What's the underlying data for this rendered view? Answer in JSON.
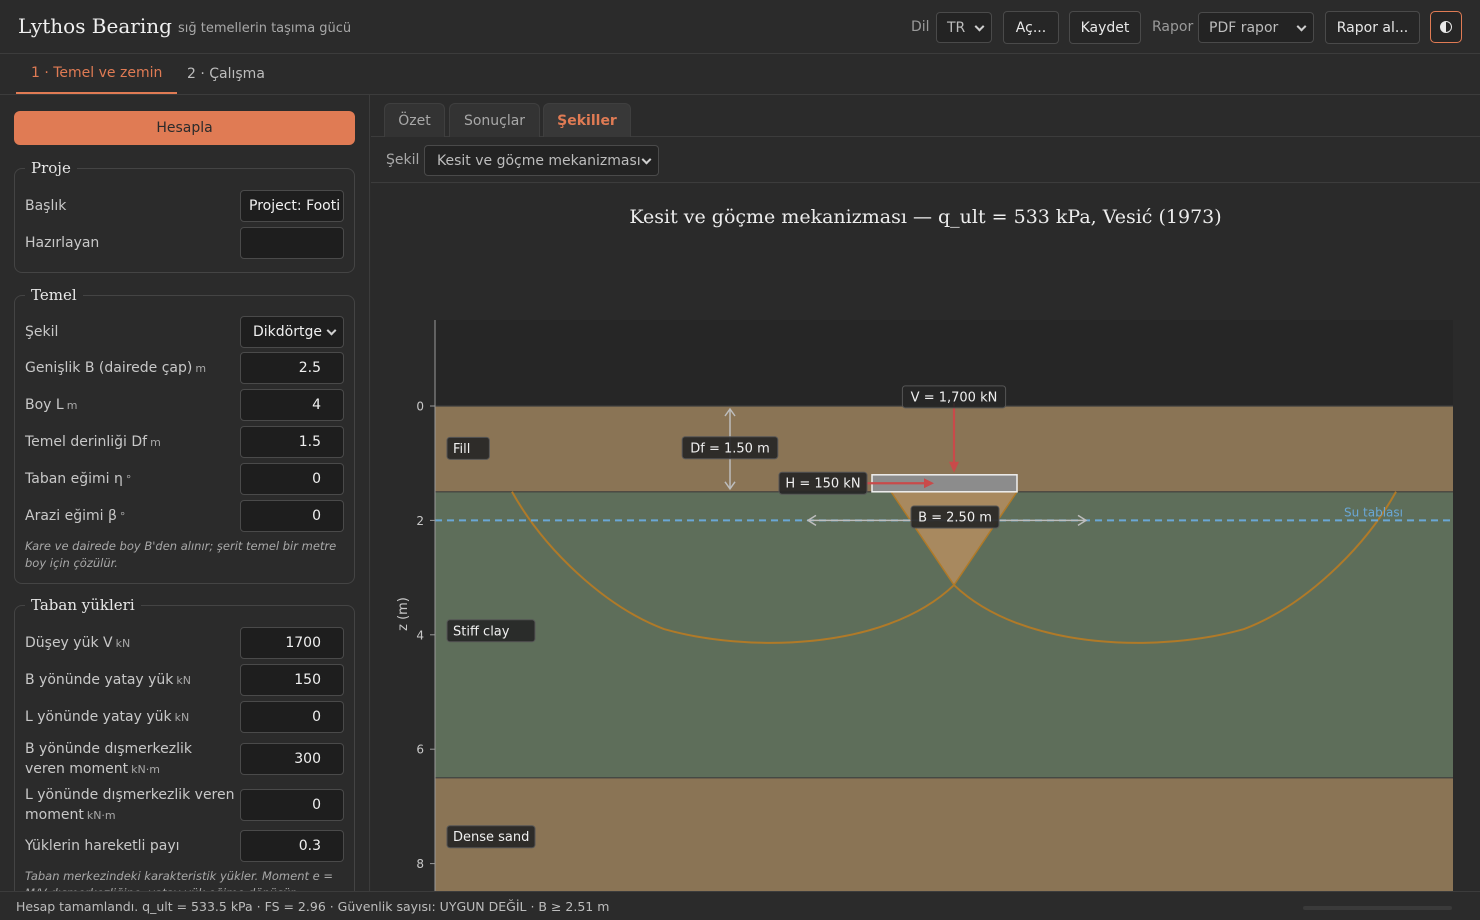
{
  "header": {
    "app_title": "Lythos Bearing",
    "app_subtitle": "sığ temellerin taşıma gücü",
    "lang_label": "Dil",
    "lang_value": "TR",
    "open_label": "Aç...",
    "save_label": "Kaydet",
    "report_label": "Rapor",
    "report_value": "PDF rapor",
    "get_report_label": "Rapor al...",
    "theme_icon": "contrast-icon"
  },
  "top_tabs": [
    {
      "label": "1 · Temel ve zemin",
      "active": true
    },
    {
      "label": "2 · Çalışma",
      "active": false
    }
  ],
  "sidebar": {
    "calculate_label": "Hesapla",
    "project": {
      "legend": "Proje",
      "title_label": "Başlık",
      "title_value": "Project: Footi",
      "prepared_label": "Hazırlayan",
      "prepared_value": ""
    },
    "foundation": {
      "legend": "Temel",
      "fields": [
        {
          "label": "Şekil",
          "unit": "",
          "value": "Dikdörtge"
        },
        {
          "label": "Genişlik B (dairede çap)",
          "unit": "m",
          "value": "2.5"
        },
        {
          "label": "Boy L",
          "unit": "m",
          "value": "4"
        },
        {
          "label": "Temel derinliği Df",
          "unit": "m",
          "value": "1.5"
        },
        {
          "label": "Taban eğimi η",
          "unit": "°",
          "value": "0"
        },
        {
          "label": "Arazi eğimi β",
          "unit": "°",
          "value": "0"
        }
      ],
      "note": "Kare ve dairede boy B'den alınır; şerit temel bir metre boy için çözülür."
    },
    "loads": {
      "legend": "Taban yükleri",
      "fields": [
        {
          "label": "Düşey yük V",
          "unit": "kN",
          "value": "1700"
        },
        {
          "label": "B yönünde yatay yük",
          "unit": "kN",
          "value": "150"
        },
        {
          "label": "L yönünde yatay yük",
          "unit": "kN",
          "value": "0"
        },
        {
          "label": "B yönünde dışmerkezlik veren moment",
          "unit": "kN·m",
          "value": "300"
        },
        {
          "label": "L yönünde dışmerkezlik veren moment",
          "unit": "kN·m",
          "value": "0"
        },
        {
          "label": "Yüklerin hareketli payı",
          "unit": "",
          "value": "0.3"
        }
      ],
      "note": "Taban merkezindeki karakteristik yükler. Moment e = M/V dışmerkezliğine, yatay yük eğime dönüşür."
    }
  },
  "results_tabs": [
    {
      "label": "Özet",
      "active": false
    },
    {
      "label": "Sonuçlar",
      "active": false
    },
    {
      "label": "Şekiller",
      "active": true
    }
  ],
  "figure_select": {
    "label": "Şekil",
    "value": "Kesit ve göçme mekanizması"
  },
  "chart_data": {
    "type": "cross-section",
    "title": "Kesit ve göçme mekanizması — q_ult = 533 kPa, Vesić (1973)",
    "ylabel": "z (m)",
    "y_ticks": [
      0,
      2,
      4,
      6,
      8
    ],
    "ylim": [
      -1.5,
      8.5
    ],
    "layers": [
      {
        "name": "Fill",
        "top": 0,
        "bottom": 1.5,
        "color": "#8a7455"
      },
      {
        "name": "Stiff clay",
        "top": 1.5,
        "bottom": 6.5,
        "color": "#5e6e5a"
      },
      {
        "name": "Dense sand",
        "top": 6.5,
        "bottom": 8.5,
        "color": "#8a7455"
      }
    ],
    "water_table": {
      "label": "Su tablası",
      "z": 2.0
    },
    "footing": {
      "B": 2.5,
      "Df": 1.5
    },
    "annotations": {
      "vertical_load": "V = 1,700 kN",
      "horizontal_load": "H = 150 kN",
      "depth": "Df = 1.50 m",
      "width": "B = 2.50 m"
    },
    "colors": {
      "load_arrow": "#c94a4a",
      "mechanism": "#b07a28",
      "water": "#6aa7d6"
    }
  },
  "status": {
    "text": "Hesap tamamlandı. q_ult = 533.5 kPa · FS = 2.96 · Güvenlik sayısı: UYGUN DEĞİL · B ≥ 2.51 m"
  }
}
